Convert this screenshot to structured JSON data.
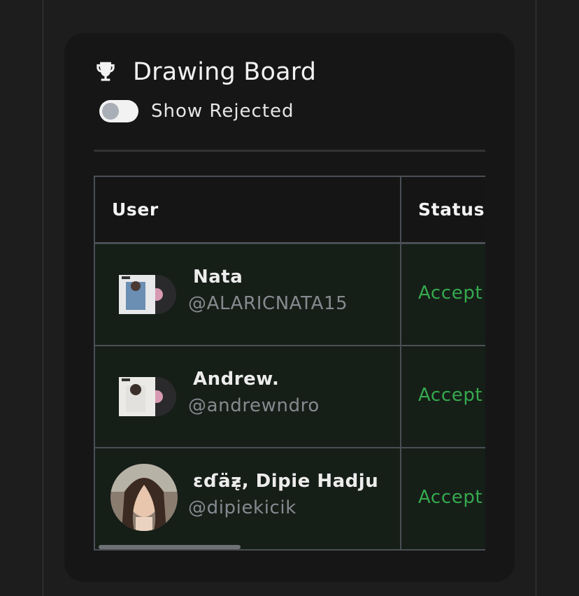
{
  "board": {
    "title": "Drawing Board",
    "icon": "trophy-icon",
    "toggle_label": "Show Rejected",
    "toggle_on": false
  },
  "table": {
    "columns": [
      "User",
      "Status"
    ],
    "rows": [
      {
        "name": "Nata",
        "handle": "@ALARICNATA15",
        "status": "Accept"
      },
      {
        "name": "Andrew.",
        "handle": "@andrewndro",
        "status": "Accept"
      },
      {
        "name": "ɛɗäƶ̨, Dipie Hadju",
        "handle": "@dipiekicik",
        "status": "Accept"
      }
    ]
  },
  "colors": {
    "accent_status": "#35a94e",
    "card_bg": "#161617",
    "row_bg": "#161e18"
  }
}
